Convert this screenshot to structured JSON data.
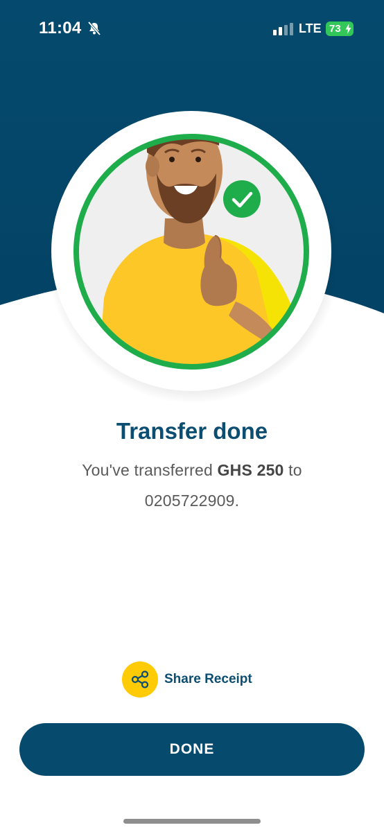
{
  "status_bar": {
    "time": "11:04",
    "network": "LTE",
    "battery_level": "73"
  },
  "hero": {
    "background_color": "#044a6f",
    "ring_color": "#1fad4b",
    "check_color": "#1fad4b",
    "illustration": "smiling-man-thumbs-up"
  },
  "content": {
    "title": "Transfer done",
    "message_prefix": "You've transferred ",
    "amount": "GHS 250",
    "message_middle": " to",
    "recipient": "0205722909",
    "message_suffix": "."
  },
  "actions": {
    "share_label": "Share Receipt",
    "share_icon": "share-icon",
    "done_label": "DONE"
  },
  "colors": {
    "primary": "#064a6e",
    "accent": "#ffcb05",
    "title": "#0c4d72"
  }
}
